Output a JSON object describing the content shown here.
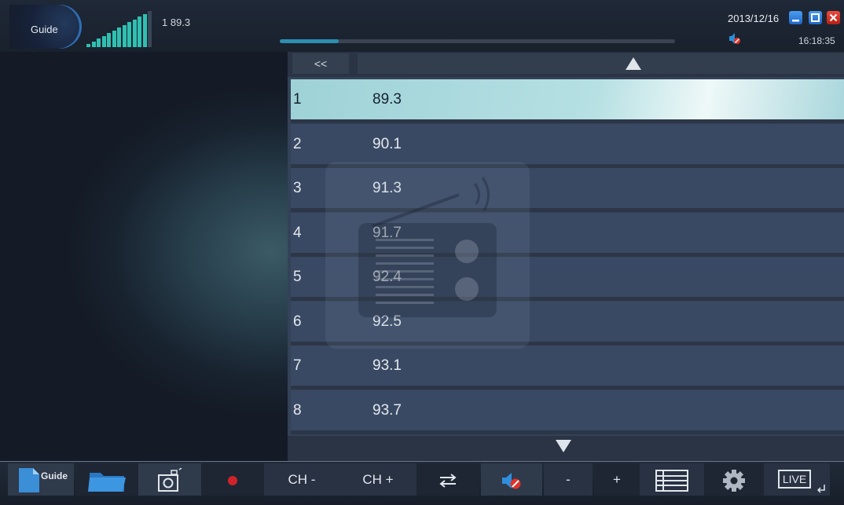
{
  "app": {
    "guide_badge": "Guide",
    "signal_readout": "1 89.3",
    "date": "2013/12/16",
    "time": "16:18:35",
    "signal_level": 0.9,
    "playback_progress": 0.15
  },
  "list": {
    "back_label": "<<",
    "channels": [
      {
        "number": "1",
        "frequency": "89.3",
        "selected": true
      },
      {
        "number": "2",
        "frequency": "90.1"
      },
      {
        "number": "3",
        "frequency": "91.3"
      },
      {
        "number": "4",
        "frequency": "91.7"
      },
      {
        "number": "5",
        "frequency": "92.4"
      },
      {
        "number": "6",
        "frequency": "92.5"
      },
      {
        "number": "7",
        "frequency": "93.1"
      },
      {
        "number": "8",
        "frequency": "93.7"
      }
    ]
  },
  "toolbar": {
    "guide_label": "Guide",
    "ch_minus": "CH -",
    "ch_plus": "CH +",
    "vol_minus": "-",
    "vol_plus": "+",
    "live_label": "LIVE"
  },
  "colors": {
    "accent": "#2fc0b2",
    "record": "#d0222a",
    "selected_row": "#b6e0e3"
  }
}
